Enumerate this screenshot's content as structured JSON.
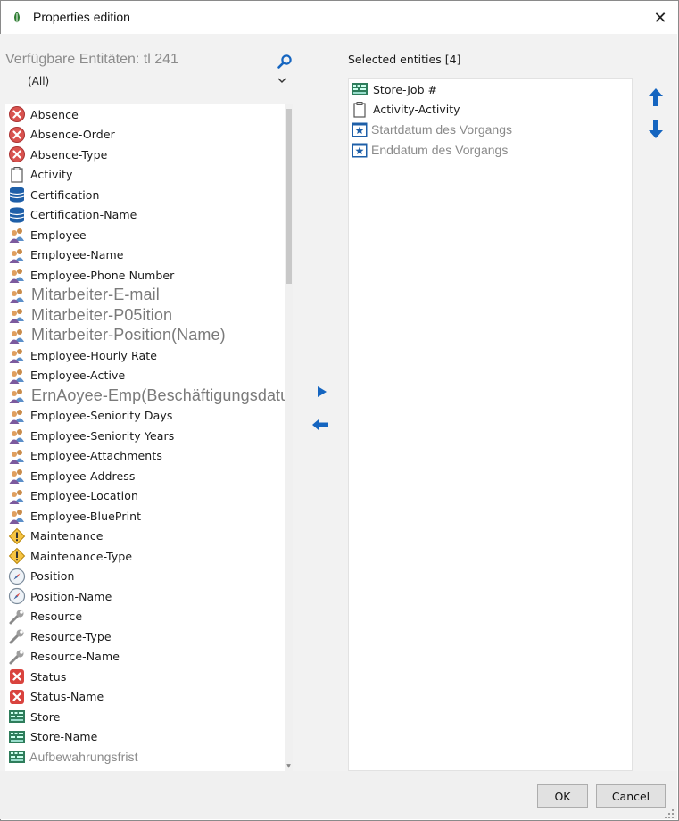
{
  "window": {
    "title": "Properties edition",
    "close_glyph": "✕"
  },
  "available": {
    "label": "Verfügbare Entitäten: tl 241",
    "filter_value": "(All)",
    "items": [
      {
        "label": "Absence",
        "icon": "red-x-circle-icon",
        "style": "normal"
      },
      {
        "label": "Absence-Order",
        "icon": "red-x-circle-icon",
        "style": "normal"
      },
      {
        "label": "Absence-Type",
        "icon": "red-x-circle-icon",
        "style": "normal"
      },
      {
        "label": "Activity",
        "icon": "clipboard-icon",
        "style": "normal"
      },
      {
        "label": "Certification",
        "icon": "database-icon",
        "style": "normal"
      },
      {
        "label": "Certification-Name",
        "icon": "database-icon",
        "style": "normal"
      },
      {
        "label": "Employee",
        "icon": "people-icon",
        "style": "normal"
      },
      {
        "label": "Employee-Name",
        "icon": "people-icon",
        "style": "normal"
      },
      {
        "label": "Employee-Phone Number",
        "icon": "people-icon",
        "style": "normal"
      },
      {
        "label": "Mitarbeiter-E-mail",
        "icon": "people-icon",
        "style": "big"
      },
      {
        "label": "Mitarbeiter-P05ition",
        "icon": "people-icon",
        "style": "big"
      },
      {
        "label": "Mitarbeiter-Position(Name)",
        "icon": "people-icon",
        "style": "big"
      },
      {
        "label": "Employee-Hourly Rate",
        "icon": "people-icon",
        "style": "normal"
      },
      {
        "label": "Employee-Active",
        "icon": "people-icon",
        "style": "normal"
      },
      {
        "label": "ErnAoyee-Emp(Beschäftigungsdatum)",
        "icon": "people-icon",
        "style": "big"
      },
      {
        "label": "Employee-Seniority Days",
        "icon": "people-icon",
        "style": "normal"
      },
      {
        "label": "Employee-Seniority Years",
        "icon": "people-icon",
        "style": "normal"
      },
      {
        "label": "Employee-Attachments",
        "icon": "people-icon",
        "style": "normal"
      },
      {
        "label": "Employee-Address",
        "icon": "people-icon",
        "style": "normal"
      },
      {
        "label": "Employee-Location",
        "icon": "people-icon",
        "style": "normal"
      },
      {
        "label": "Employee-BluePrint",
        "icon": "people-icon",
        "style": "normal"
      },
      {
        "label": "Maintenance",
        "icon": "warning-icon",
        "style": "normal"
      },
      {
        "label": "Maintenance-Type",
        "icon": "warning-icon",
        "style": "normal"
      },
      {
        "label": "Position",
        "icon": "compass-icon",
        "style": "normal"
      },
      {
        "label": "Position-Name",
        "icon": "compass-icon",
        "style": "normal"
      },
      {
        "label": "Resource",
        "icon": "wrench-icon",
        "style": "normal"
      },
      {
        "label": "Resource-Type",
        "icon": "wrench-icon",
        "style": "normal"
      },
      {
        "label": "Resource-Name",
        "icon": "wrench-icon",
        "style": "normal"
      },
      {
        "label": "Status",
        "icon": "red-x-square-icon",
        "style": "normal"
      },
      {
        "label": "Status-Name",
        "icon": "red-x-square-icon",
        "style": "normal"
      },
      {
        "label": "Store",
        "icon": "store-board-icon",
        "style": "normal"
      },
      {
        "label": "Store-Name",
        "icon": "store-board-icon",
        "style": "normal"
      },
      {
        "label": "Aufbewahrungsfrist",
        "icon": "store-board-icon",
        "style": "light"
      }
    ]
  },
  "selected": {
    "label": "Selected entities [4]",
    "items": [
      {
        "label": "Store-Job #",
        "icon": "store-board-icon",
        "style": "normal"
      },
      {
        "label": "Activity-Activity",
        "icon": "clipboard-icon",
        "style": "normal"
      },
      {
        "label": "Startdatum des Vorgangs",
        "icon": "star-calendar-icon",
        "style": "light"
      },
      {
        "label": "Enddatum des Vorgangs",
        "icon": "star-calendar-icon",
        "style": "light"
      }
    ]
  },
  "buttons": {
    "ok": "OK",
    "cancel": "Cancel"
  },
  "colors": {
    "accent_arrow": "#1565c0",
    "dialog_bg": "#f2f2f2",
    "muted_text": "#8c8c8c"
  }
}
